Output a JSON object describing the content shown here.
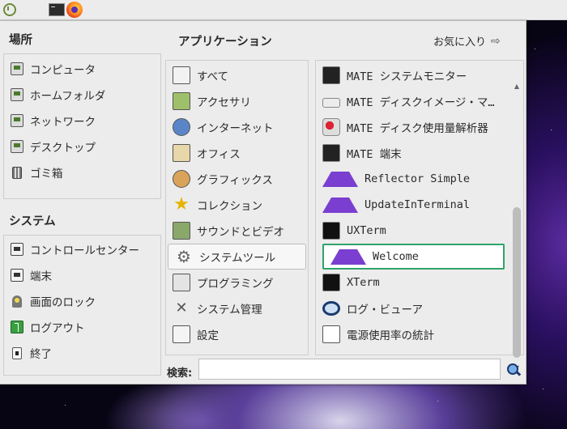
{
  "places": {
    "title": "場所",
    "items": [
      {
        "label": "コンピュータ",
        "icon": "computer-icon"
      },
      {
        "label": "ホームフォルダ",
        "icon": "home-folder-icon"
      },
      {
        "label": "ネットワーク",
        "icon": "network-icon"
      },
      {
        "label": "デスクトップ",
        "icon": "desktop-folder-icon"
      },
      {
        "label": "ゴミ箱",
        "icon": "trash-icon"
      }
    ]
  },
  "system": {
    "title": "システム",
    "items": [
      {
        "label": "コントロールセンター",
        "icon": "control-center-icon"
      },
      {
        "label": "端末",
        "icon": "terminal-icon"
      },
      {
        "label": "画面のロック",
        "icon": "lock-screen-icon"
      },
      {
        "label": "ログアウト",
        "icon": "logout-icon"
      },
      {
        "label": "終了",
        "icon": "shutdown-icon"
      }
    ]
  },
  "applications": {
    "title": "アプリケーション",
    "favorites_label": "お気に入り",
    "categories": [
      {
        "label": "すべて",
        "icon": "all-apps-icon"
      },
      {
        "label": "アクセサリ",
        "icon": "accessories-icon"
      },
      {
        "label": "インターネット",
        "icon": "internet-icon"
      },
      {
        "label": "オフィス",
        "icon": "office-icon"
      },
      {
        "label": "グラフィックス",
        "icon": "graphics-icon"
      },
      {
        "label": "コレクション",
        "icon": "collection-star-icon"
      },
      {
        "label": "サウンドとビデオ",
        "icon": "sound-video-icon"
      },
      {
        "label": "システムツール",
        "icon": "system-tools-icon",
        "selected": true
      },
      {
        "label": "プログラミング",
        "icon": "programming-icon"
      },
      {
        "label": "システム管理",
        "icon": "administration-icon"
      },
      {
        "label": "設定",
        "icon": "settings-icon"
      }
    ],
    "apps": [
      {
        "label": "MATE システムモニター",
        "icon": "system-monitor-icon"
      },
      {
        "label": "MATE ディスクイメージ・マ…",
        "icon": "disk-image-icon"
      },
      {
        "label": "MATE ディスク使用量解析器",
        "icon": "disk-usage-icon"
      },
      {
        "label": "MATE 端末",
        "icon": "terminal-icon"
      },
      {
        "label": "Reflector Simple",
        "icon": "arch-logo-icon"
      },
      {
        "label": "UpdateInTerminal",
        "icon": "arch-logo-icon"
      },
      {
        "label": "UXTerm",
        "icon": "xterm-icon"
      },
      {
        "label": "Welcome",
        "icon": "arch-logo-icon",
        "selected": true
      },
      {
        "label": "XTerm",
        "icon": "xterm-icon"
      },
      {
        "label": "ログ・ビューア",
        "icon": "log-viewer-icon"
      },
      {
        "label": "電源使用率の統計",
        "icon": "power-statistics-icon"
      }
    ]
  },
  "search": {
    "label": "検索:",
    "value": "",
    "placeholder": ""
  },
  "colors": {
    "selection_border": "#2fa36a",
    "menu_background": "#ececec",
    "accent_purple": "#7a3fd0"
  }
}
